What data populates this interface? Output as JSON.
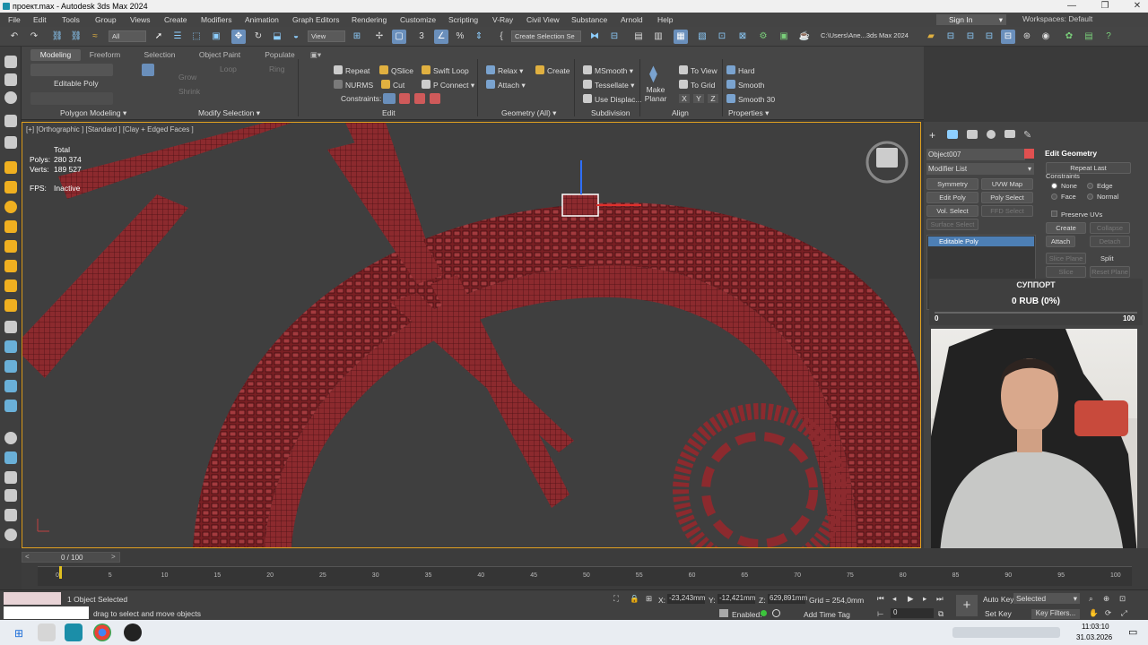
{
  "window": {
    "title": "проект.max - Autodesk 3ds Max 2024"
  },
  "menu": [
    "File",
    "Edit",
    "Tools",
    "Group",
    "Views",
    "Create",
    "Modifiers",
    "Animation",
    "Graph Editors",
    "Rendering",
    "Customize",
    "Scripting",
    "V-Ray",
    "Civil View",
    "Substance",
    "Arnold",
    "Help"
  ],
  "account": {
    "signin": "Sign In",
    "workspaces": "Workspaces: Default"
  },
  "toolbar": {
    "selection_filter": "All",
    "view_dd": "View",
    "named_selection": "Create Selection Se",
    "path": "C:\\Users\\Ane...3ds Max 2024"
  },
  "ribbon": {
    "tabs": [
      "Modeling",
      "Freeform",
      "Selection",
      "Object Paint",
      "Populate"
    ],
    "active_tab": "Modeling",
    "editable_poly": "Editable Poly",
    "grow": "Grow",
    "shrink": "Shrink",
    "loop": "Loop",
    "ring": "Ring",
    "edit": {
      "repeat": "Repeat",
      "qslice": "QSlice",
      "swift_loop": "Swift Loop",
      "nurms": "NURMS",
      "cut": "Cut",
      "p_connect": "P Connect",
      "constraints": "Constraints:"
    },
    "geometry": {
      "relax": "Relax",
      "create": "Create",
      "attach": "Attach"
    },
    "subdivision": {
      "msmooth": "MSmooth",
      "tessellate": "Tessellate",
      "use_displace": "Use Displac..."
    },
    "align": {
      "make_planar": "Make Planar",
      "to_view": "To View",
      "to_grid": "To Grid",
      "x": "X",
      "y": "Y",
      "z": "Z"
    },
    "properties": {
      "hard": "Hard",
      "smooth": "Smooth",
      "smooth30": "Smooth 30"
    },
    "groups": [
      "Polygon Modeling",
      "Modify Selection",
      "Edit",
      "Geometry (All)",
      "Subdivision",
      "Align",
      "Properties"
    ]
  },
  "viewport": {
    "label": "[+] [Orthographic ] [Standard ] [Clay + Edged Faces ]",
    "total": "Total",
    "polys_label": "Polys:",
    "polys": "280 374",
    "verts_label": "Verts:",
    "verts": "189 527",
    "fps_label": "FPS:",
    "fps": "Inactive"
  },
  "command_panel": {
    "object_name": "Object007",
    "modifier_list": "Modifier List",
    "buttons": [
      "Symmetry",
      "UVW Map",
      "Edit Poly",
      "Poly Select",
      "Vol. Select",
      "FFD Select",
      "Surface Select"
    ],
    "stack_item": "Editable Poly",
    "edit_geometry": "Edit Geometry",
    "repeat_last": "Repeat Last",
    "constraints": "Constraints",
    "none": "None",
    "edge": "Edge",
    "face": "Face",
    "normal": "Normal",
    "preserve_uvs": "Preserve UVs",
    "create": "Create",
    "collapse": "Collapse",
    "attach": "Attach",
    "detach": "Detach",
    "slice_plane": "Slice Plane",
    "split": "Split",
    "slice": "Slice",
    "reset_plane": "Reset Plane"
  },
  "donation": {
    "title": "СУППОРТ",
    "amount": "0 RUB (0%)",
    "min": "0",
    "max": "100"
  },
  "timeline": {
    "frame": "0 / 100",
    "ticks": [
      "0",
      "5",
      "10",
      "15",
      "20",
      "25",
      "30",
      "35",
      "40",
      "45",
      "50",
      "55",
      "60",
      "65",
      "70",
      "75",
      "80",
      "85",
      "90",
      "95",
      "100"
    ]
  },
  "status": {
    "selected": "1 Object Selected",
    "prompt": "drag to select and move objects",
    "x_label": "X:",
    "x": "-23,243mm",
    "y_label": "Y:",
    "y": "-12,421mm",
    "z_label": "Z:",
    "z": "629,891mm",
    "grid": "Grid = 254,0mm",
    "enabled": "Enabled:",
    "add_time_tag": "Add Time Tag",
    "auto_key": "Auto Key",
    "set_key": "Set Key",
    "selected_dd": "Selected",
    "key_filters": "Key Filters...",
    "frame_field": "0"
  },
  "taskbar": {
    "time": "11:03:10",
    "date": "31.03.2026"
  }
}
